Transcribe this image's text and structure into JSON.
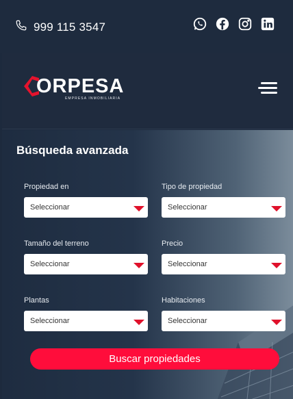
{
  "topbar": {
    "phone": "999 115 3547",
    "socials": [
      "whatsapp-icon",
      "facebook-icon",
      "instagram-icon",
      "linkedin-icon"
    ]
  },
  "header": {
    "logo_word": "ORPESA",
    "logo_sub": "EMPRESA INMOBILIARIA"
  },
  "search": {
    "title": "Búsqueda avanzada",
    "fields": [
      {
        "label": "Propiedad en",
        "value": "Seleccionar"
      },
      {
        "label": "Tipo de propiedad",
        "value": "Seleccionar"
      },
      {
        "label": "Tamaño del terreno",
        "value": "Seleccionar"
      },
      {
        "label": "Precio",
        "value": "Seleccionar"
      },
      {
        "label": "Plantas",
        "value": "Seleccionar"
      },
      {
        "label": "Habitaciones",
        "value": "Seleccionar"
      }
    ],
    "button": "Buscar propiedades"
  },
  "colors": {
    "primary": "#ff0d3b",
    "dark": "#1e2b3e"
  }
}
